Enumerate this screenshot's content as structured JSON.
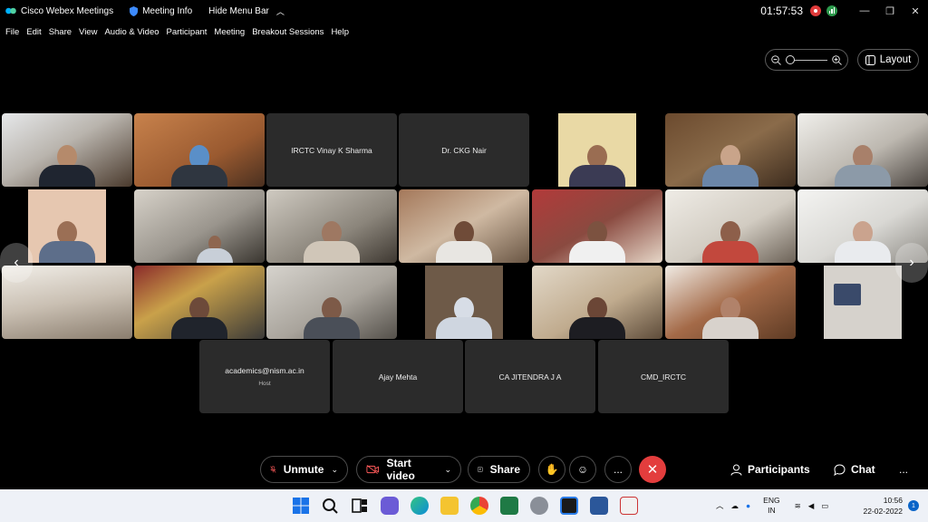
{
  "titlebar": {
    "app_title": "Cisco Webex Meetings",
    "meeting_info": "Meeting Info",
    "hide_menu_bar": "Hide Menu Bar",
    "timer": "01:57:53"
  },
  "menu": [
    "File",
    "Edit",
    "Share",
    "View",
    "Audio & Video",
    "Participant",
    "Meeting",
    "Breakout Sessions",
    "Help"
  ],
  "toolbar_top": {
    "layout_label": "Layout"
  },
  "name_tiles": {
    "vinay": "IRCTC Vinay K Sharma",
    "ckg": "Dr. CKG Nair",
    "academics": "academics@nism.ac.in",
    "academics_role": "Host",
    "ajay": "Ajay Mehta",
    "jitendra": "CA JITENDRA J A",
    "cmd": "CMD_IRCTC"
  },
  "controls": {
    "unmute": "Unmute",
    "start_video": "Start video",
    "share": "Share",
    "participants": "Participants",
    "chat": "Chat",
    "more": "..."
  },
  "taskbar": {
    "lang_line1": "ENG",
    "lang_line2": "IN",
    "time": "10:56",
    "date": "22-02-2022",
    "notifications": "1"
  },
  "colors": {
    "end_meeting": "#e33d3d",
    "recording": "#e03b3b",
    "network": "#2c9a4c",
    "taskbar": "#eef1f7"
  }
}
